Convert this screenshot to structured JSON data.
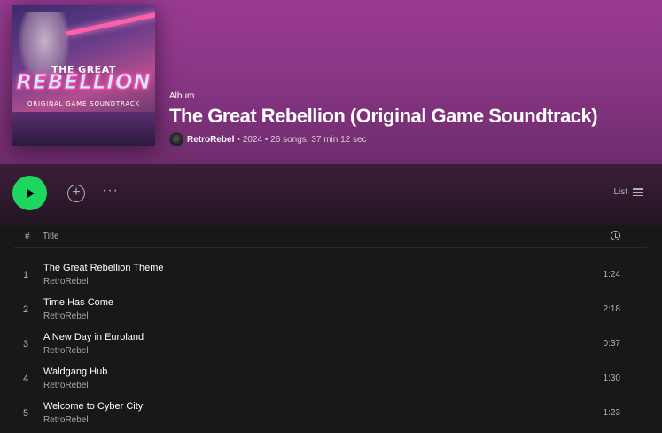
{
  "album": {
    "type_label": "Album",
    "title": "The Great Rebellion (Original Game Soundtrack)",
    "artist": "RetroRebel",
    "meta_rest": "2024 • 26 songs, 37 min 12 sec",
    "cover": {
      "line1": "THE GREAT",
      "line2": "REBELLION",
      "line3": "ORIGINAL GAME SOUNDTRACK"
    }
  },
  "actions": {
    "more_label": "···",
    "add_label": "+",
    "view_label": "List"
  },
  "table": {
    "headers": {
      "number": "#",
      "title": "Title"
    },
    "tracks": [
      {
        "number": "1",
        "title": "The Great Rebellion Theme",
        "artist": "RetroRebel",
        "duration": "1:24"
      },
      {
        "number": "2",
        "title": "Time Has Come",
        "artist": "RetroRebel",
        "duration": "2:18"
      },
      {
        "number": "3",
        "title": "A New Day in Euroland",
        "artist": "RetroRebel",
        "duration": "0:37"
      },
      {
        "number": "4",
        "title": "Waldgang Hub",
        "artist": "RetroRebel",
        "duration": "1:30"
      },
      {
        "number": "5",
        "title": "Welcome to Cyber City",
        "artist": "RetroRebel",
        "duration": "1:23"
      }
    ]
  },
  "colors": {
    "accent": "#1ed760",
    "header_gradient_top": "#9a3a92",
    "background": "#121212"
  },
  "icons": [
    "play-icon",
    "add-circle-icon",
    "more-options-icon",
    "list-view-icon",
    "clock-icon"
  ]
}
